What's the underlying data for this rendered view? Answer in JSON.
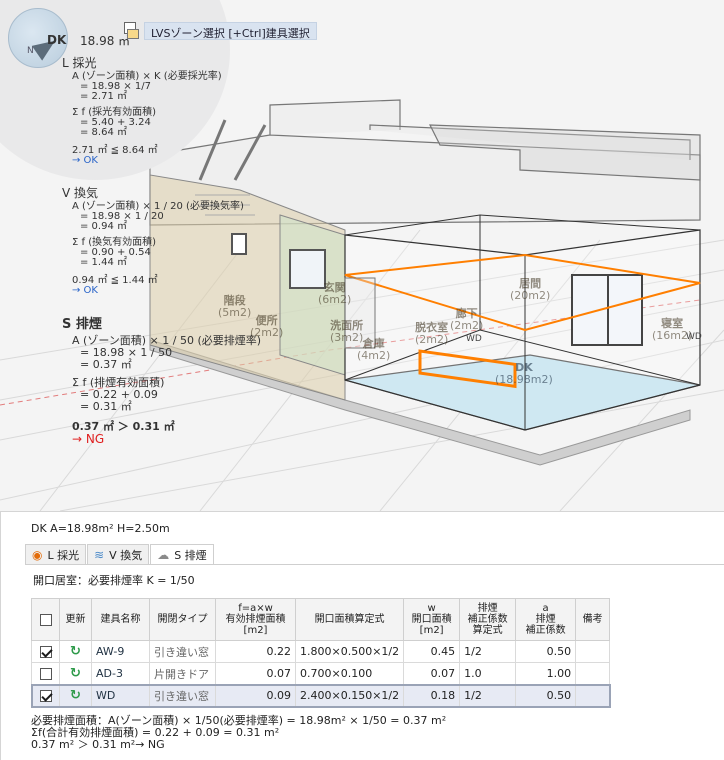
{
  "viewport": {
    "compass_n": "N",
    "compass_label": "DK",
    "area_readout": "18.98 ㎡",
    "zone_select_label": "LVSゾーン選択 [+Ctrl]建具選択",
    "lighting": {
      "heading": "L 採光",
      "lines": [
        "A (ゾーン面積) × K (必要採光率)",
        "= 18.98 × 1/7",
        "= 2.71 ㎡"
      ],
      "sum_lines": [
        "Σ f (採光有効面積)",
        "= 5.40 + 3.24",
        "= 8.64 ㎡"
      ],
      "compare": "2.71 ㎡ ≦ 8.64 ㎡",
      "verdict": "→ OK"
    },
    "ventilation": {
      "heading": "V 換気",
      "lines": [
        "A (ゾーン面積) × 1 / 20 (必要換気率)",
        "= 18.98 × 1 / 20",
        "= 0.94 ㎡"
      ],
      "sum_lines": [
        "Σ f (換気有効面積)",
        "= 0.90 + 0.54",
        "= 1.44 ㎡"
      ],
      "compare": "0.94 ㎡ ≦ 1.44 ㎡",
      "verdict": "→ OK"
    },
    "smoke": {
      "heading": "S 排煙",
      "lines": [
        "A (ゾーン面積) × 1 / 50 (必要排煙率)",
        "= 18.98 × 1 / 50",
        "= 0.37 ㎡"
      ],
      "sum_lines": [
        "Σ f (排煙有効面積)",
        "= 0.22 + 0.09",
        "= 0.31 ㎡"
      ],
      "compare": "0.37 ㎡  ＞ 0.31 ㎡",
      "verdict": "→ NG"
    },
    "rooms": {
      "stairs": "階段",
      "stairs_area": "(5m2)",
      "toilet": "便所",
      "toilet_area": "(2m2)",
      "entrance": "玄関",
      "entrance_area": "(6m2)",
      "washroom": "洗面所",
      "washroom_area": "(3m2)",
      "storage": "倉庫",
      "storage_area": "(4m2)",
      "closet": "脱衣室",
      "closet_area": "(2m2)",
      "hall": "廊下",
      "hall_area": "(2m2)",
      "living": "居間",
      "living_area": "(20m2)",
      "bedroom": "寝室",
      "bedroom_area": "(16m2)",
      "dk": "DK",
      "dk_area": "(18.98m2)"
    },
    "tags": {
      "wd1": "WD",
      "wd2": "WD"
    }
  },
  "panel": {
    "room_info": "DK  A=18.98m²  H=2.50m",
    "tabs": [
      {
        "label": "L 採光",
        "icon": "sun-icon"
      },
      {
        "label": "V 換気",
        "icon": "wind-icon"
      },
      {
        "label": "S 排煙",
        "icon": "smoke-icon"
      }
    ],
    "rate_note": "開口居室：必要排煙率 K = 1/50",
    "columns": {
      "check": "",
      "update": "更新",
      "name": "建具名称",
      "type": "開閉タイプ",
      "effective": [
        "f=a×w",
        "有効排煙面積",
        "[m2]"
      ],
      "formula": "開口面積算定式",
      "opening": [
        "w",
        "開口面積",
        "[m2]"
      ],
      "corr_formula": [
        "排煙",
        "補正係数",
        "算定式"
      ],
      "corr": [
        "a",
        "排煙",
        "補正係数"
      ],
      "note": "備考"
    },
    "rows": [
      {
        "checked": true,
        "name": "AW-9",
        "type": "引き違い窓",
        "effective": "0.22",
        "formula": "1.800×0.500×1/2",
        "opening": "0.45",
        "corr_formula": "1/2",
        "corr": "0.50",
        "note": ""
      },
      {
        "checked": false,
        "name": "AD-3",
        "type": "片開きドア",
        "effective": "0.07",
        "formula": "0.700×0.100",
        "opening": "0.07",
        "corr_formula": "1.0",
        "corr": "1.00",
        "note": ""
      },
      {
        "checked": true,
        "name": "WD",
        "type": "引き違い窓",
        "effective": "0.09",
        "formula": "2.400×0.150×1/2",
        "opening": "0.18",
        "corr_formula": "1/2",
        "corr": "0.50",
        "note": ""
      }
    ],
    "summary": [
      "必要排煙面積：A(ゾーン面積) × 1/50(必要排煙率) = 18.98m² × 1/50 = 0.37 m²",
      "Σf(合計有効排煙面積) = 0.22 + 0.09  = 0.31 m²",
      "0.37 m²  ＞ 0.31 m²→ NG"
    ]
  },
  "colors": {
    "ng": "#e02020",
    "ok": "#2a64c8",
    "highlight_orange": "#ff7f00",
    "dk_floor": "#bfe0ee",
    "zone_select_bg": "#d9e3f0"
  }
}
